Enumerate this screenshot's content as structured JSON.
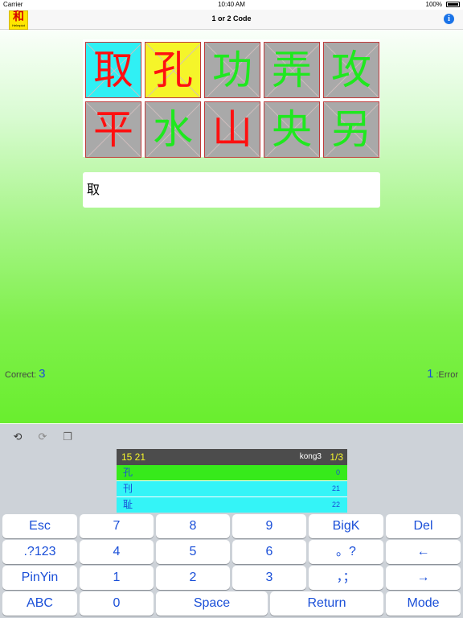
{
  "status_bar": {
    "carrier": "Carrier",
    "time": "10:40 AM",
    "battery": "100%"
  },
  "nav": {
    "logo_char": "和",
    "logo_sub": "Helmpiot",
    "title": "1 or 2 Code",
    "info_label": "i"
  },
  "practice": {
    "characters": [
      {
        "char": "取",
        "color": "#ff1010",
        "state": "current"
      },
      {
        "char": "孔",
        "color": "#ff1010",
        "state": "highlighted"
      },
      {
        "char": "功",
        "color": "#1fe81f"
      },
      {
        "char": "弄",
        "color": "#1fe81f"
      },
      {
        "char": "攻",
        "color": "#1fe81f"
      },
      {
        "char": "平",
        "color": "#ff1010"
      },
      {
        "char": "水",
        "color": "#1fe81f"
      },
      {
        "char": "山",
        "color": "#ff1010"
      },
      {
        "char": "央",
        "color": "#1fe81f"
      },
      {
        "char": "另",
        "color": "#1fe81f"
      }
    ],
    "input_text": "取",
    "correct_label": "Correct:",
    "correct_count": "3",
    "error_count": "1",
    "error_label": ":Error"
  },
  "toolbar": {
    "undo_icon": "undo-icon",
    "redo_icon": "redo-icon",
    "paste_icon": "paste-icon"
  },
  "candidates": {
    "code": "15 21",
    "pinyin": "kong3",
    "page": "1/3",
    "items": [
      {
        "char": "孔",
        "code": "0"
      },
      {
        "char": "刊",
        "code": "21"
      },
      {
        "char": "耻",
        "code": "22"
      }
    ]
  },
  "keyboard": {
    "rows": [
      [
        "Esc",
        "7",
        "8",
        "9",
        "BigK",
        "Del"
      ],
      [
        ".?123",
        "4",
        "5",
        "6",
        "。?",
        "←"
      ],
      [
        "PinYin",
        "1",
        "2",
        "3",
        "，；",
        "→"
      ],
      [
        "ABC",
        "0",
        "Space",
        "Return",
        "Mode"
      ]
    ]
  },
  "colors": {
    "accent": "#1a4fd8",
    "current_cell": "#30f0f4",
    "highlight_cell": "#f5f52a",
    "selected_candidate": "#37ea1b",
    "candidate_bg": "#34f4f7"
  }
}
